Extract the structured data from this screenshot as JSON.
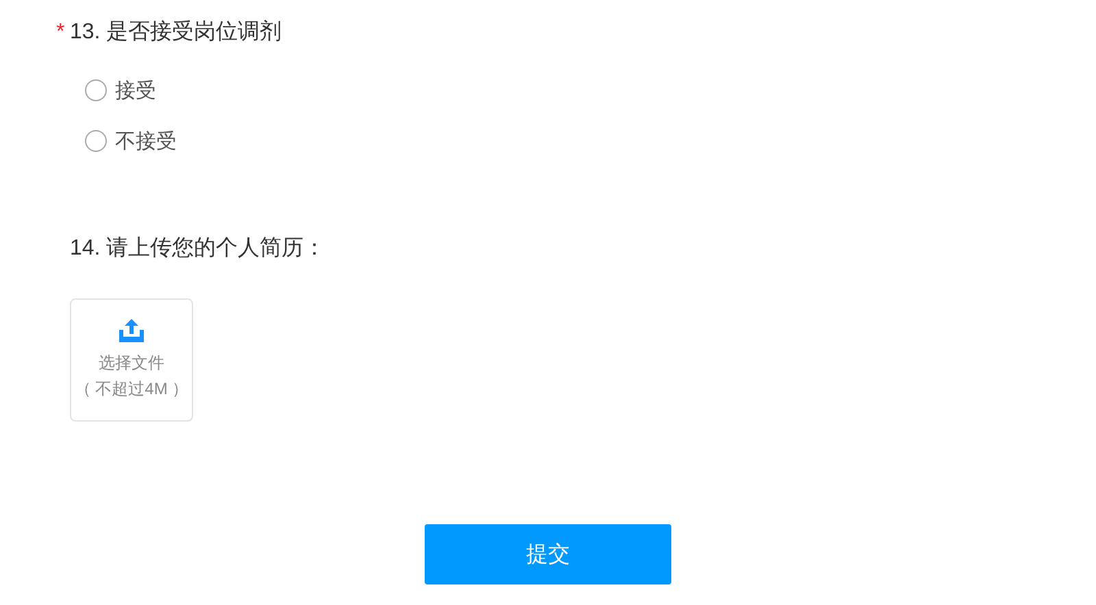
{
  "questions": [
    {
      "kind": "radio",
      "required_mark": "*",
      "title": "13. 是否接受岗位调剂",
      "options": [
        {
          "label": "接受",
          "selected": false
        },
        {
          "label": "不接受",
          "selected": false
        }
      ]
    },
    {
      "kind": "upload",
      "title": "14. 请上传您的个人简历：",
      "upload": {
        "label": "选择文件",
        "hint": "（ 不超过4M ）"
      }
    }
  ],
  "submit": {
    "label": "提交"
  }
}
